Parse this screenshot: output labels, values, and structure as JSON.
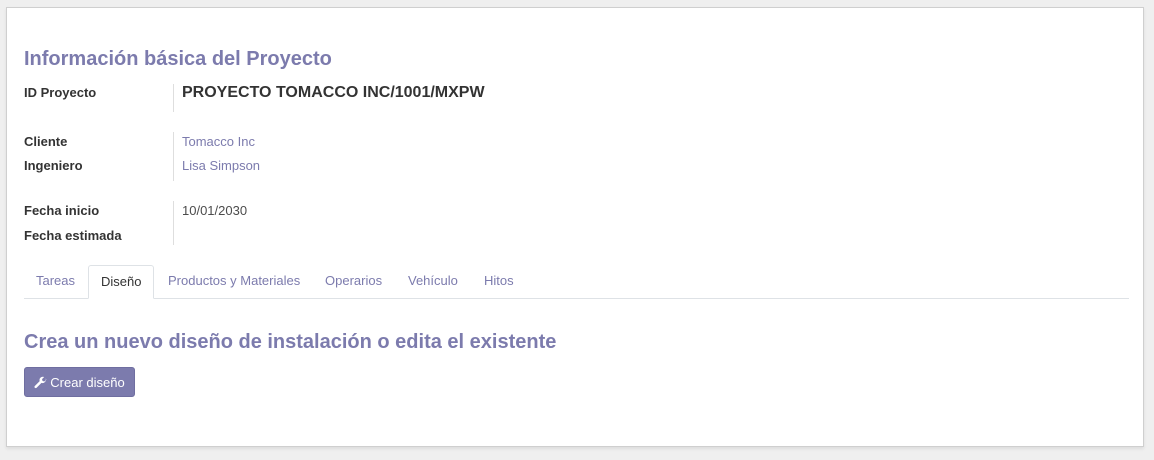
{
  "project_info": {
    "section_title": "Información básica del Proyecto",
    "fields": {
      "id_label": "ID Proyecto",
      "id_value": "PROYECTO TOMACCO INC/1001/MXPW",
      "client_label": "Cliente",
      "client_value": "Tomacco Inc",
      "engineer_label": "Ingeniero",
      "engineer_value": "Lisa Simpson",
      "start_date_label": "Fecha inicio",
      "start_date_value": "10/01/2030",
      "estimated_date_label": "Fecha estimada",
      "estimated_date_value": ""
    }
  },
  "tabs": [
    {
      "label": "Tareas",
      "active": false
    },
    {
      "label": "Diseño",
      "active": true
    },
    {
      "label": "Productos y Materiales",
      "active": false
    },
    {
      "label": "Operarios",
      "active": false
    },
    {
      "label": "Vehículo",
      "active": false
    },
    {
      "label": "Hitos",
      "active": false
    }
  ],
  "design_tab": {
    "title": "Crea un nuevo diseño de instalación o edita el existente",
    "button_label": "Crear diseño",
    "button_icon": "wrench-icon"
  },
  "colors": {
    "accent": "#7c7bad",
    "text": "#4c4c4c",
    "background": "#efefef"
  }
}
